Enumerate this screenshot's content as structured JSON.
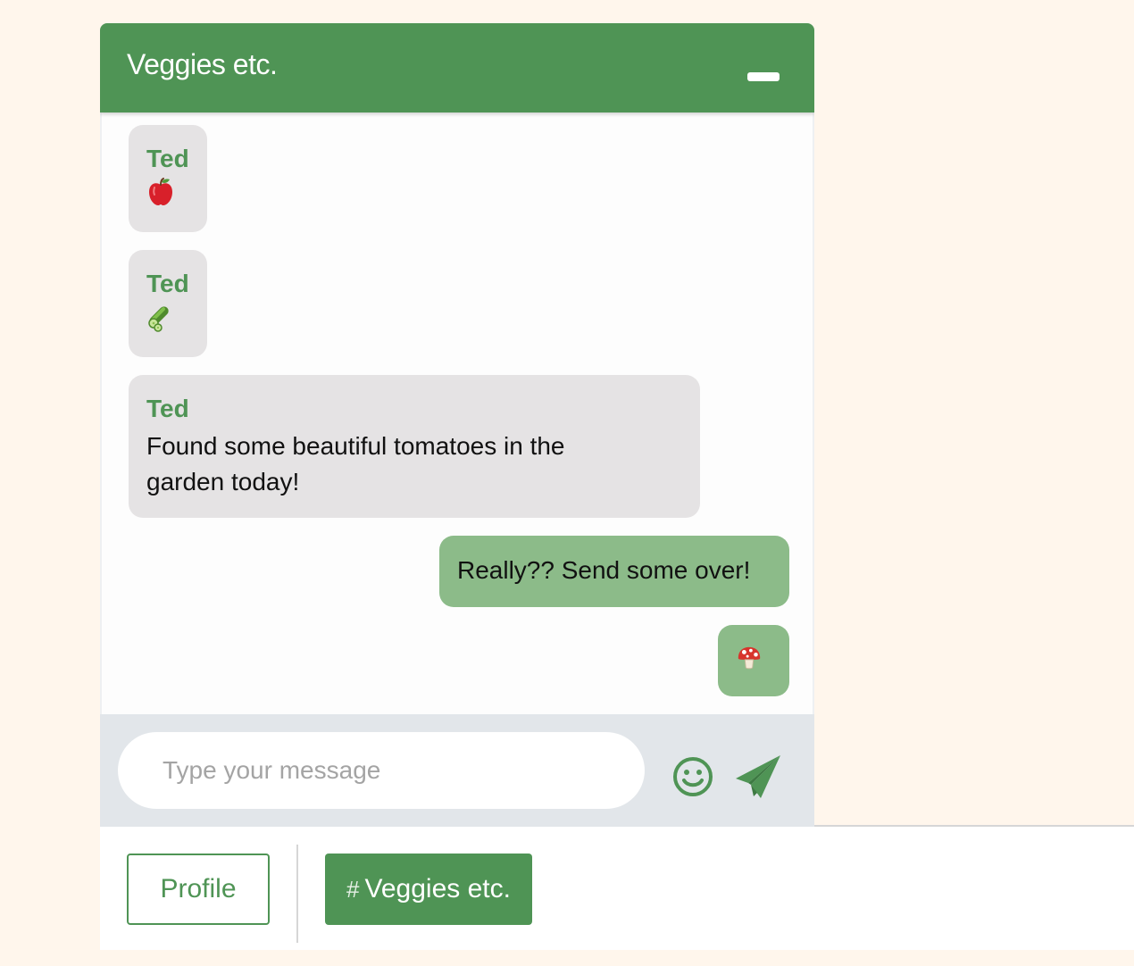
{
  "header": {
    "title": "Veggies etc."
  },
  "messages": [
    {
      "direction": "incoming",
      "sender": "Ted",
      "emoji": "apple-emoji"
    },
    {
      "direction": "incoming",
      "sender": "Ted",
      "emoji": "cucumber-emoji"
    },
    {
      "direction": "incoming",
      "sender": "Ted",
      "line1": "Found some beautiful tomatoes in the",
      "line2": "garden today!"
    },
    {
      "direction": "outgoing",
      "text": "Really?? Send some over!"
    },
    {
      "direction": "outgoing",
      "emoji": "mushroom-emoji"
    }
  ],
  "composer": {
    "placeholder": "Type your message",
    "value": "",
    "emoji_icon": "smiley-icon",
    "send_icon": "paper-plane-icon"
  },
  "footer": {
    "profile_label": "Profile",
    "channel_hash": "#",
    "channel_label": "Veggies etc."
  },
  "colors": {
    "brand_green": "#4f9455",
    "outgoing_bubble": "#8cbb89",
    "incoming_bubble": "#e5e3e4",
    "page_background": "#fff6ec",
    "composer_bar": "#e2e6ea"
  }
}
